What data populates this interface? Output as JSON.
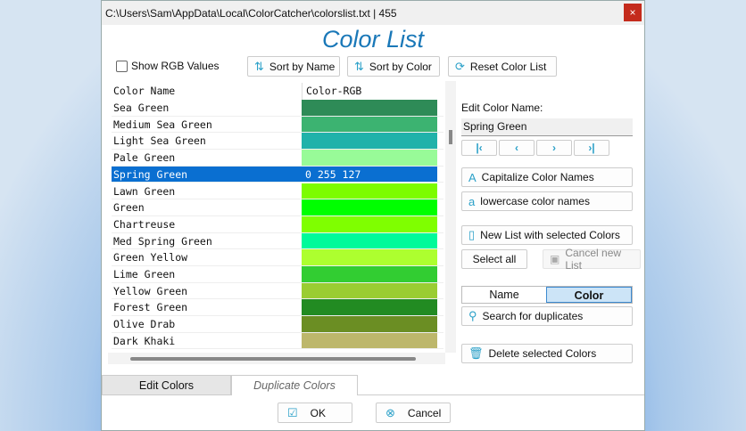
{
  "window": {
    "title": "C:\\Users\\Sam\\AppData\\Local\\ColorCatcher\\colorslist.txt | 455",
    "close": "×",
    "heading": "Color List"
  },
  "toolbar": {
    "show_rgb": "Show RGB Values",
    "sort_name": "Sort by Name",
    "sort_color": "Sort by Color",
    "reset": "Reset Color List"
  },
  "table": {
    "headers": [
      "Color Name",
      "Color-RGB"
    ],
    "rows": [
      {
        "name": "Sea Green",
        "color": "#2e8b57",
        "rgb": ""
      },
      {
        "name": "Medium Sea Green",
        "color": "#3cb371",
        "rgb": ""
      },
      {
        "name": "Light Sea Green",
        "color": "#20b2aa",
        "rgb": ""
      },
      {
        "name": "Pale Green",
        "color": "#98fb98",
        "rgb": ""
      },
      {
        "name": "Spring Green",
        "color": "#0a6fd1",
        "rgb": "0 255 127",
        "selected": true
      },
      {
        "name": "Lawn Green",
        "color": "#7cfc00",
        "rgb": ""
      },
      {
        "name": "Green",
        "color": "#00ff00",
        "rgb": ""
      },
      {
        "name": "Chartreuse",
        "color": "#7fff00",
        "rgb": ""
      },
      {
        "name": "Med Spring Green",
        "color": "#00fa9a",
        "rgb": ""
      },
      {
        "name": "Green Yellow",
        "color": "#adff2f",
        "rgb": ""
      },
      {
        "name": "Lime Green",
        "color": "#32cd32",
        "rgb": ""
      },
      {
        "name": "Yellow Green",
        "color": "#9acd32",
        "rgb": ""
      },
      {
        "name": "Forest Green",
        "color": "#228b22",
        "rgb": ""
      },
      {
        "name": "Olive Drab",
        "color": "#6b8e23",
        "rgb": ""
      },
      {
        "name": "Dark Khaki",
        "color": "#bdb76b",
        "rgb": ""
      }
    ]
  },
  "edit": {
    "label": "Edit Color Name:",
    "value": "Spring Green",
    "nav": [
      "|‹",
      "‹",
      "›",
      "›|"
    ]
  },
  "actions": {
    "capitalize": "Capitalize Color Names",
    "lowercase": "lowercase color names",
    "new_list": "New List with selected Colors",
    "select_all": "Select all",
    "cancel_list": "Cancel new List",
    "seg_name": "Name",
    "seg_color": "Color",
    "search_dup": "Search for duplicates",
    "delete": "Delete selected Colors"
  },
  "tabs": {
    "edit": "Edit Colors",
    "dup": "Duplicate Colors"
  },
  "footer": {
    "ok": "OK",
    "cancel": "Cancel"
  }
}
